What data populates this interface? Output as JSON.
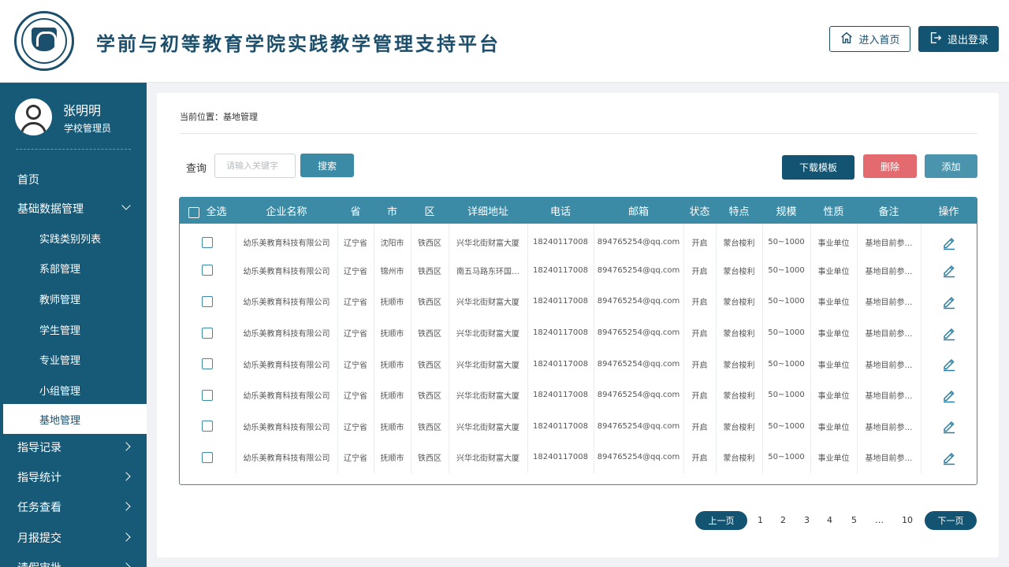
{
  "header": {
    "title": "学前与初等教育学院实践教学管理支持平台",
    "home_button": "进入首页",
    "logout_button": "退出登录",
    "home_icon": "home-icon",
    "logout_icon": "logout-icon"
  },
  "user": {
    "name": "张明明",
    "role": "学校管理员"
  },
  "sidebar": {
    "items": [
      {
        "label": "首页"
      },
      {
        "label": "基础数据管理"
      },
      {
        "label": "实践类别列表"
      },
      {
        "label": "系部管理"
      },
      {
        "label": "教师管理"
      },
      {
        "label": "学生管理"
      },
      {
        "label": "专业管理"
      },
      {
        "label": "小组管理"
      },
      {
        "label": "基地管理"
      },
      {
        "label": "指导记录"
      },
      {
        "label": "指导统计"
      },
      {
        "label": "任务查看"
      },
      {
        "label": "月报提交"
      },
      {
        "label": "请假审批"
      }
    ]
  },
  "breadcrumb": {
    "text": "当前位置：基地管理"
  },
  "toolbar": {
    "query_label": "查询",
    "search_placeholder": "请输入关键字",
    "search_button": "搜索",
    "download_button": "下载模板",
    "delete_button": "删除",
    "add_button": "添加"
  },
  "table": {
    "headers": [
      "全选",
      "企业名称",
      "省",
      "市",
      "区",
      "详细地址",
      "电话",
      "邮箱",
      "状态",
      "特点",
      "规模",
      "性质",
      "备注",
      "操作"
    ],
    "rows": [
      [
        "幼乐美教育科技有限公司",
        "辽宁省",
        "沈阳市",
        "铁西区",
        "兴华北街财富大厦",
        "18240117008",
        "894765254@qq.com",
        "开启",
        "蒙台梭利",
        "50~1000",
        "事业单位",
        "基地目前参…"
      ],
      [
        "幼乐美教育科技有限公司",
        "辽宁省",
        "锦州市",
        "铁西区",
        "南五马路东环国…",
        "18240117008",
        "894765254@qq.com",
        "开启",
        "蒙台梭利",
        "50~1000",
        "事业单位",
        "基地目前参…"
      ],
      [
        "幼乐美教育科技有限公司",
        "辽宁省",
        "抚顺市",
        "铁西区",
        "兴华北街财富大厦",
        "18240117008",
        "894765254@qq.com",
        "开启",
        "蒙台梭利",
        "50~1000",
        "事业单位",
        "基地目前参…"
      ],
      [
        "幼乐美教育科技有限公司",
        "辽宁省",
        "抚顺市",
        "铁西区",
        "兴华北街财富大厦",
        "18240117008",
        "894765254@qq.com",
        "开启",
        "蒙台梭利",
        "50~1000",
        "事业单位",
        "基地目前参…"
      ],
      [
        "幼乐美教育科技有限公司",
        "辽宁省",
        "抚顺市",
        "铁西区",
        "兴华北街财富大厦",
        "18240117008",
        "894765254@qq.com",
        "开启",
        "蒙台梭利",
        "50~1000",
        "事业单位",
        "基地目前参…"
      ],
      [
        "幼乐美教育科技有限公司",
        "辽宁省",
        "抚顺市",
        "铁西区",
        "兴华北街财富大厦",
        "18240117008",
        "894765254@qq.com",
        "开启",
        "蒙台梭利",
        "50~1000",
        "事业单位",
        "基地目前参…"
      ],
      [
        "幼乐美教育科技有限公司",
        "辽宁省",
        "抚顺市",
        "铁西区",
        "兴华北街财富大厦",
        "18240117008",
        "894765254@qq.com",
        "开启",
        "蒙台梭利",
        "50~1000",
        "事业单位",
        "基地目前参…"
      ],
      [
        "幼乐美教育科技有限公司",
        "辽宁省",
        "抚顺市",
        "铁西区",
        "兴华北街财富大厦",
        "18240117008",
        "894765254@qq.com",
        "开启",
        "蒙台梭利",
        "50~1000",
        "事业单位",
        "基地目前参…"
      ]
    ],
    "action_icon": "edit-icon"
  },
  "pagination": {
    "prev": "上一页",
    "next": "下一页",
    "pages": [
      "1",
      "2",
      "3",
      "4",
      "5",
      "…",
      "10"
    ]
  },
  "colors": {
    "primary": "#135472",
    "sidebar": "#175a78",
    "accent": "#3b8aa6",
    "danger": "#e36b6f"
  }
}
